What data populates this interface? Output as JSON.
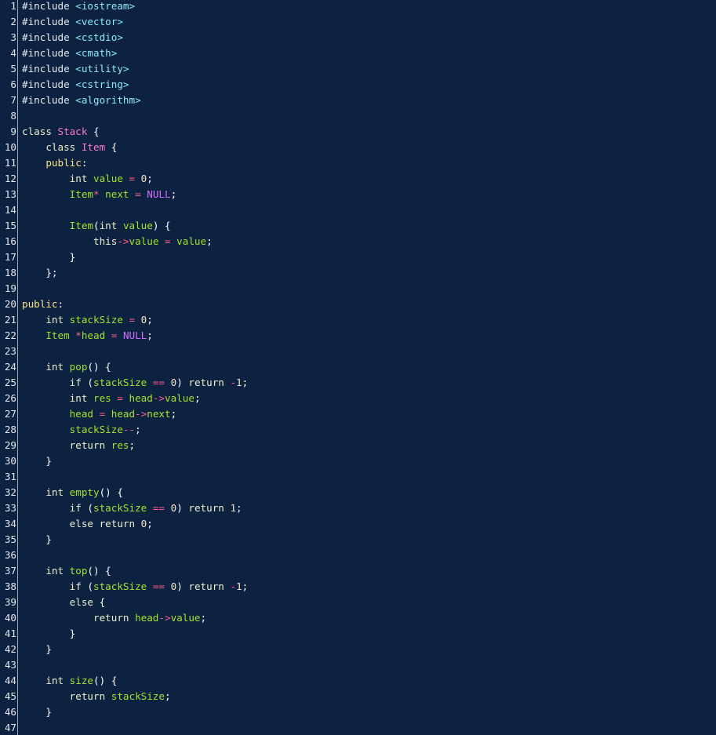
{
  "editor": {
    "lines": [
      {
        "n": "1",
        "tokens": [
          {
            "t": "#include ",
            "c": "pre"
          },
          {
            "t": "<iostream>",
            "c": "inc"
          }
        ]
      },
      {
        "n": "2",
        "tokens": [
          {
            "t": "#include ",
            "c": "pre"
          },
          {
            "t": "<vector>",
            "c": "inc"
          }
        ]
      },
      {
        "n": "3",
        "tokens": [
          {
            "t": "#include ",
            "c": "pre"
          },
          {
            "t": "<cstdio>",
            "c": "inc"
          }
        ]
      },
      {
        "n": "4",
        "tokens": [
          {
            "t": "#include ",
            "c": "pre"
          },
          {
            "t": "<cmath>",
            "c": "inc"
          }
        ]
      },
      {
        "n": "5",
        "tokens": [
          {
            "t": "#include ",
            "c": "pre"
          },
          {
            "t": "<utility>",
            "c": "inc"
          }
        ]
      },
      {
        "n": "6",
        "tokens": [
          {
            "t": "#include ",
            "c": "pre"
          },
          {
            "t": "<cstring>",
            "c": "inc"
          }
        ]
      },
      {
        "n": "7",
        "tokens": [
          {
            "t": "#include ",
            "c": "pre"
          },
          {
            "t": "<algorithm>",
            "c": "inc"
          }
        ]
      },
      {
        "n": "8",
        "tokens": []
      },
      {
        "n": "9",
        "tokens": [
          {
            "t": "class ",
            "c": "kw"
          },
          {
            "t": "Stack",
            "c": "cls"
          },
          {
            "t": " {",
            "c": "pun"
          }
        ]
      },
      {
        "n": "10",
        "tokens": [
          {
            "t": "    class ",
            "c": "kw"
          },
          {
            "t": "Item",
            "c": "cls"
          },
          {
            "t": " {",
            "c": "pun"
          }
        ]
      },
      {
        "n": "11",
        "tokens": [
          {
            "t": "    public",
            "c": "mod"
          },
          {
            "t": ":",
            "c": "pun"
          }
        ]
      },
      {
        "n": "12",
        "tokens": [
          {
            "t": "        int ",
            "c": "kw"
          },
          {
            "t": "value",
            "c": "var"
          },
          {
            "t": " = ",
            "c": "op"
          },
          {
            "t": "0",
            "c": "num"
          },
          {
            "t": ";",
            "c": "pun"
          }
        ]
      },
      {
        "n": "13",
        "tokens": [
          {
            "t": "        Item",
            "c": "type"
          },
          {
            "t": "*",
            "c": "op"
          },
          {
            "t": " next",
            "c": "var"
          },
          {
            "t": " = ",
            "c": "op"
          },
          {
            "t": "NULL",
            "c": "null"
          },
          {
            "t": ";",
            "c": "pun"
          }
        ]
      },
      {
        "n": "14",
        "tokens": []
      },
      {
        "n": "15",
        "tokens": [
          {
            "t": "        Item",
            "c": "type"
          },
          {
            "t": "(",
            "c": "pun"
          },
          {
            "t": "int ",
            "c": "kw"
          },
          {
            "t": "value",
            "c": "var"
          },
          {
            "t": ") {",
            "c": "pun"
          }
        ]
      },
      {
        "n": "16",
        "tokens": [
          {
            "t": "            this",
            "c": "kw"
          },
          {
            "t": "->",
            "c": "op"
          },
          {
            "t": "value",
            "c": "var"
          },
          {
            "t": " = ",
            "c": "op"
          },
          {
            "t": "value",
            "c": "var"
          },
          {
            "t": ";",
            "c": "pun"
          }
        ]
      },
      {
        "n": "17",
        "tokens": [
          {
            "t": "        }",
            "c": "pun"
          }
        ]
      },
      {
        "n": "18",
        "tokens": [
          {
            "t": "    };",
            "c": "pun"
          }
        ]
      },
      {
        "n": "19",
        "tokens": []
      },
      {
        "n": "20",
        "tokens": [
          {
            "t": "public",
            "c": "mod"
          },
          {
            "t": ":",
            "c": "pun"
          }
        ]
      },
      {
        "n": "21",
        "tokens": [
          {
            "t": "    int ",
            "c": "kw"
          },
          {
            "t": "stackSize",
            "c": "var"
          },
          {
            "t": " = ",
            "c": "op"
          },
          {
            "t": "0",
            "c": "num"
          },
          {
            "t": ";",
            "c": "pun"
          }
        ]
      },
      {
        "n": "22",
        "tokens": [
          {
            "t": "    Item ",
            "c": "type"
          },
          {
            "t": "*",
            "c": "op"
          },
          {
            "t": "head",
            "c": "var"
          },
          {
            "t": " = ",
            "c": "op"
          },
          {
            "t": "NULL",
            "c": "null"
          },
          {
            "t": ";",
            "c": "pun"
          }
        ]
      },
      {
        "n": "23",
        "tokens": []
      },
      {
        "n": "24",
        "tokens": [
          {
            "t": "    int ",
            "c": "kw"
          },
          {
            "t": "pop",
            "c": "var"
          },
          {
            "t": "() {",
            "c": "pun"
          }
        ]
      },
      {
        "n": "25",
        "tokens": [
          {
            "t": "        if ",
            "c": "kw"
          },
          {
            "t": "(",
            "c": "pun"
          },
          {
            "t": "stackSize",
            "c": "var"
          },
          {
            "t": " == ",
            "c": "op"
          },
          {
            "t": "0",
            "c": "num"
          },
          {
            "t": ") ",
            "c": "pun"
          },
          {
            "t": "return ",
            "c": "kw"
          },
          {
            "t": "-",
            "c": "op"
          },
          {
            "t": "1",
            "c": "num"
          },
          {
            "t": ";",
            "c": "pun"
          }
        ]
      },
      {
        "n": "26",
        "tokens": [
          {
            "t": "        int ",
            "c": "kw"
          },
          {
            "t": "res",
            "c": "var"
          },
          {
            "t": " = ",
            "c": "op"
          },
          {
            "t": "head",
            "c": "var"
          },
          {
            "t": "->",
            "c": "op"
          },
          {
            "t": "value",
            "c": "var"
          },
          {
            "t": ";",
            "c": "pun"
          }
        ]
      },
      {
        "n": "27",
        "tokens": [
          {
            "t": "        head",
            "c": "var"
          },
          {
            "t": " = ",
            "c": "op"
          },
          {
            "t": "head",
            "c": "var"
          },
          {
            "t": "->",
            "c": "op"
          },
          {
            "t": "next",
            "c": "var"
          },
          {
            "t": ";",
            "c": "pun"
          }
        ]
      },
      {
        "n": "28",
        "tokens": [
          {
            "t": "        stackSize",
            "c": "var"
          },
          {
            "t": "--",
            "c": "op"
          },
          {
            "t": ";",
            "c": "pun"
          }
        ]
      },
      {
        "n": "29",
        "tokens": [
          {
            "t": "        return ",
            "c": "kw"
          },
          {
            "t": "res",
            "c": "var"
          },
          {
            "t": ";",
            "c": "pun"
          }
        ]
      },
      {
        "n": "30",
        "tokens": [
          {
            "t": "    }",
            "c": "pun"
          }
        ]
      },
      {
        "n": "31",
        "tokens": []
      },
      {
        "n": "32",
        "tokens": [
          {
            "t": "    int ",
            "c": "kw"
          },
          {
            "t": "empty",
            "c": "var"
          },
          {
            "t": "() {",
            "c": "pun"
          }
        ]
      },
      {
        "n": "33",
        "tokens": [
          {
            "t": "        if ",
            "c": "kw"
          },
          {
            "t": "(",
            "c": "pun"
          },
          {
            "t": "stackSize",
            "c": "var"
          },
          {
            "t": " == ",
            "c": "op"
          },
          {
            "t": "0",
            "c": "num"
          },
          {
            "t": ") ",
            "c": "pun"
          },
          {
            "t": "return ",
            "c": "kw"
          },
          {
            "t": "1",
            "c": "num"
          },
          {
            "t": ";",
            "c": "pun"
          }
        ]
      },
      {
        "n": "34",
        "tokens": [
          {
            "t": "        else return ",
            "c": "kw"
          },
          {
            "t": "0",
            "c": "num"
          },
          {
            "t": ";",
            "c": "pun"
          }
        ]
      },
      {
        "n": "35",
        "tokens": [
          {
            "t": "    }",
            "c": "pun"
          }
        ]
      },
      {
        "n": "36",
        "tokens": []
      },
      {
        "n": "37",
        "tokens": [
          {
            "t": "    int ",
            "c": "kw"
          },
          {
            "t": "top",
            "c": "var"
          },
          {
            "t": "() {",
            "c": "pun"
          }
        ]
      },
      {
        "n": "38",
        "tokens": [
          {
            "t": "        if ",
            "c": "kw"
          },
          {
            "t": "(",
            "c": "pun"
          },
          {
            "t": "stackSize",
            "c": "var"
          },
          {
            "t": " == ",
            "c": "op"
          },
          {
            "t": "0",
            "c": "num"
          },
          {
            "t": ") ",
            "c": "pun"
          },
          {
            "t": "return ",
            "c": "kw"
          },
          {
            "t": "-",
            "c": "op"
          },
          {
            "t": "1",
            "c": "num"
          },
          {
            "t": ";",
            "c": "pun"
          }
        ]
      },
      {
        "n": "39",
        "tokens": [
          {
            "t": "        else ",
            "c": "kw"
          },
          {
            "t": "{",
            "c": "pun"
          }
        ]
      },
      {
        "n": "40",
        "tokens": [
          {
            "t": "            return ",
            "c": "kw"
          },
          {
            "t": "head",
            "c": "var"
          },
          {
            "t": "->",
            "c": "op"
          },
          {
            "t": "value",
            "c": "var"
          },
          {
            "t": ";",
            "c": "pun"
          }
        ]
      },
      {
        "n": "41",
        "tokens": [
          {
            "t": "        }",
            "c": "pun"
          }
        ]
      },
      {
        "n": "42",
        "tokens": [
          {
            "t": "    }",
            "c": "pun"
          }
        ]
      },
      {
        "n": "43",
        "tokens": []
      },
      {
        "n": "44",
        "tokens": [
          {
            "t": "    int ",
            "c": "kw"
          },
          {
            "t": "size",
            "c": "var"
          },
          {
            "t": "() {",
            "c": "pun"
          }
        ]
      },
      {
        "n": "45",
        "tokens": [
          {
            "t": "        return ",
            "c": "kw"
          },
          {
            "t": "stackSize",
            "c": "var"
          },
          {
            "t": ";",
            "c": "pun"
          }
        ]
      },
      {
        "n": "46",
        "tokens": [
          {
            "t": "    }",
            "c": "pun"
          }
        ]
      },
      {
        "n": "47",
        "tokens": []
      }
    ]
  },
  "colors": {
    "background": "#0c2240",
    "gutter_border": "#9aa7b8",
    "line_number": "#e4e8ee",
    "preprocessor": "#e8ecf2",
    "include_path": "#8be9fd",
    "keyword": "#eef0d0",
    "access_modifier": "#ffe48a",
    "class_name": "#ff79c6",
    "identifier": "#a6e22e",
    "operator": "#ff5c8a",
    "number": "#f4e6c8",
    "null_literal": "#d56cff",
    "punctuation": "#ffffff"
  }
}
